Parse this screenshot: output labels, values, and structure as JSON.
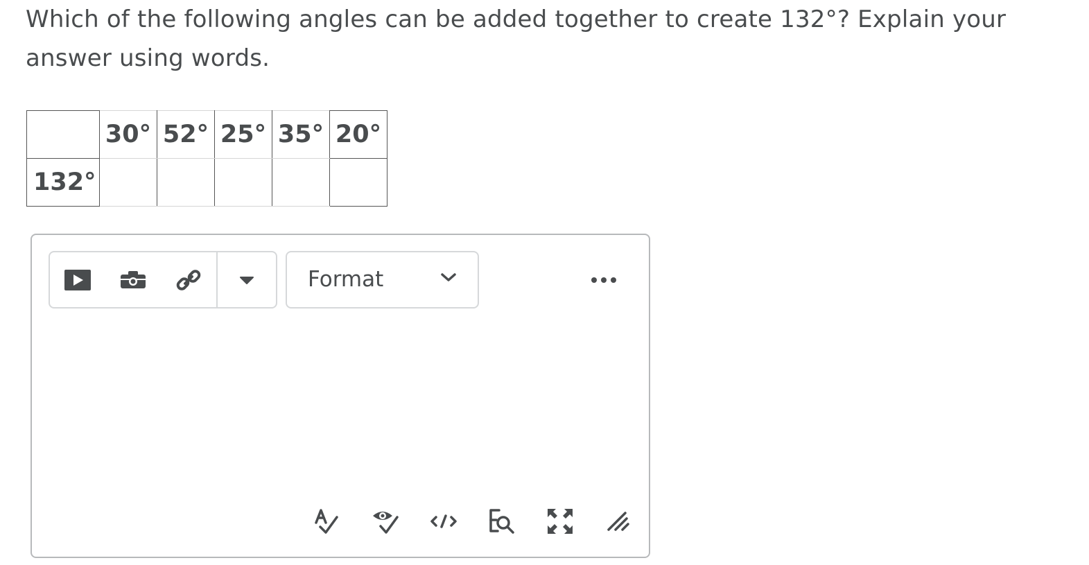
{
  "question": {
    "text": "Which of the following angles can be added together to create 132°? Explain your answer using words."
  },
  "table": {
    "header_values": [
      "30°",
      "52°",
      "25°",
      "35°",
      "20°"
    ],
    "row_label": "132°"
  },
  "editor": {
    "format_label": "Format",
    "toolbar_icons": [
      "video-icon",
      "camera-icon",
      "link-icon",
      "dropdown-caret-icon"
    ],
    "more_icon": "more-options-icon",
    "bottom_icons": [
      "spellcheck-icon",
      "accessibility-check-icon",
      "source-code-icon",
      "find-replace-icon",
      "fullscreen-icon",
      "resize-handle-icon"
    ]
  },
  "colors": {
    "text": "#494c4e",
    "border": "#b7b9bb",
    "icon": "#494c4e"
  }
}
